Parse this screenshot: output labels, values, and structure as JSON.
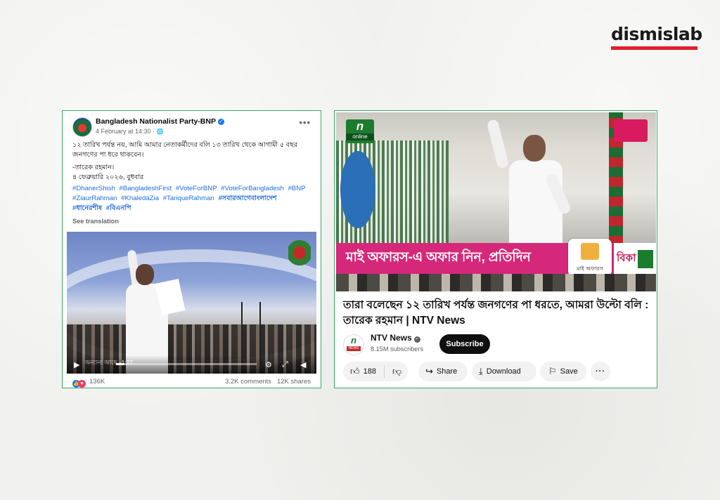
{
  "brand": {
    "name": "dismislab",
    "accent": "#e0202a"
  },
  "facebook_post": {
    "page_name": "Bangladesh Nationalist Party-BNP",
    "date": "4 February at 14:30 · ",
    "globe_icon": "🌐",
    "body": [
      "১২ তারিখ পর্যন্ত নয়, আমি আমার নেতাকর্মীদের বলি ১৩ তারিখ থেকে আগামী ৫ বছর জনগণের পা ধরে থাকবেন।",
      "-তারেক রহমান।",
      "৪ ফেব্রুয়ারি ২০২৬, বুধবার"
    ],
    "hashtags": [
      "#DhanerShish",
      "#BangladeshFirst",
      "#VoteForBNP",
      "#VoteForBangladesh",
      "#BNP",
      "#ZiaurRahman",
      "#KhaledaZia",
      "#TariqueRahman",
      "#সবারআগেবাংলাদেশ",
      "#ধানেরশীষ",
      "#বিএনপি"
    ],
    "see_translation": "See translation",
    "video": {
      "watermark": "অন্যান্য আছে",
      "time": "-1:27",
      "progress": 0.06
    },
    "reactions_count": "136K",
    "comments": "3.2K comments",
    "shares": "12K shares"
  },
  "youtube_video": {
    "channel_logo": {
      "n": "n",
      "online": "online"
    },
    "banner": {
      "text": "মাই অফারস-এ অফার নিন, প্রতিদিন",
      "badge_label": "মাই অফারস",
      "tail": "বিকা"
    },
    "title": "তারা বলেছেন ১২ তারিখ পর্যন্ত জনগণের পা ধরতে, আমরা উল্টো বলি : তারেক রহমান | NTV News",
    "channel": {
      "name": "NTV News",
      "subscribers": "8.15M subscribers",
      "avatar_n": "n",
      "avatar_news": "NEWS"
    },
    "subscribe_label": "Subscribe",
    "likes": "188",
    "share_label": "Share",
    "download_label": "Download",
    "save_label": "Save",
    "more_label": "···"
  },
  "colors": {
    "card_border": "#3aa866",
    "fb_link": "#216fdb",
    "banner_pink": "#d6287a",
    "ntv_green": "#1c7c2e"
  }
}
